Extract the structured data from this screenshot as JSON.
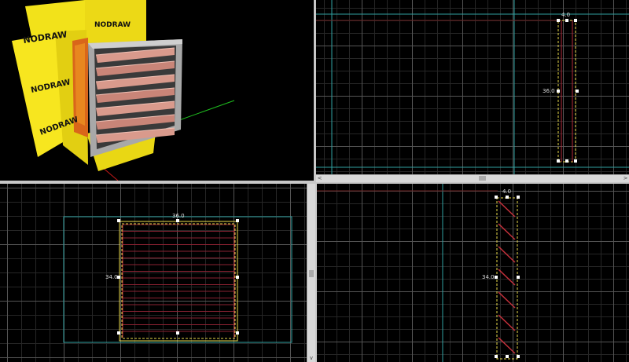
{
  "texture_label": "NODRAW",
  "viewports": {
    "top": {
      "width_label": "4.0",
      "height_label": "36.0"
    },
    "front": {
      "width_label": "36.0",
      "height_label": "34.0"
    },
    "side": {
      "width_label": "4.0",
      "height_label": "34.0"
    }
  },
  "scrollbars": {
    "left_arrow": "<",
    "right_arrow": ">",
    "down_arrow": "v"
  },
  "colors": {
    "nodraw_yellow": "#f5e41c",
    "selection_yellow": "#e6e04a",
    "brush_red": "#b52a3a",
    "cyan_line": "#5fb0b0"
  }
}
